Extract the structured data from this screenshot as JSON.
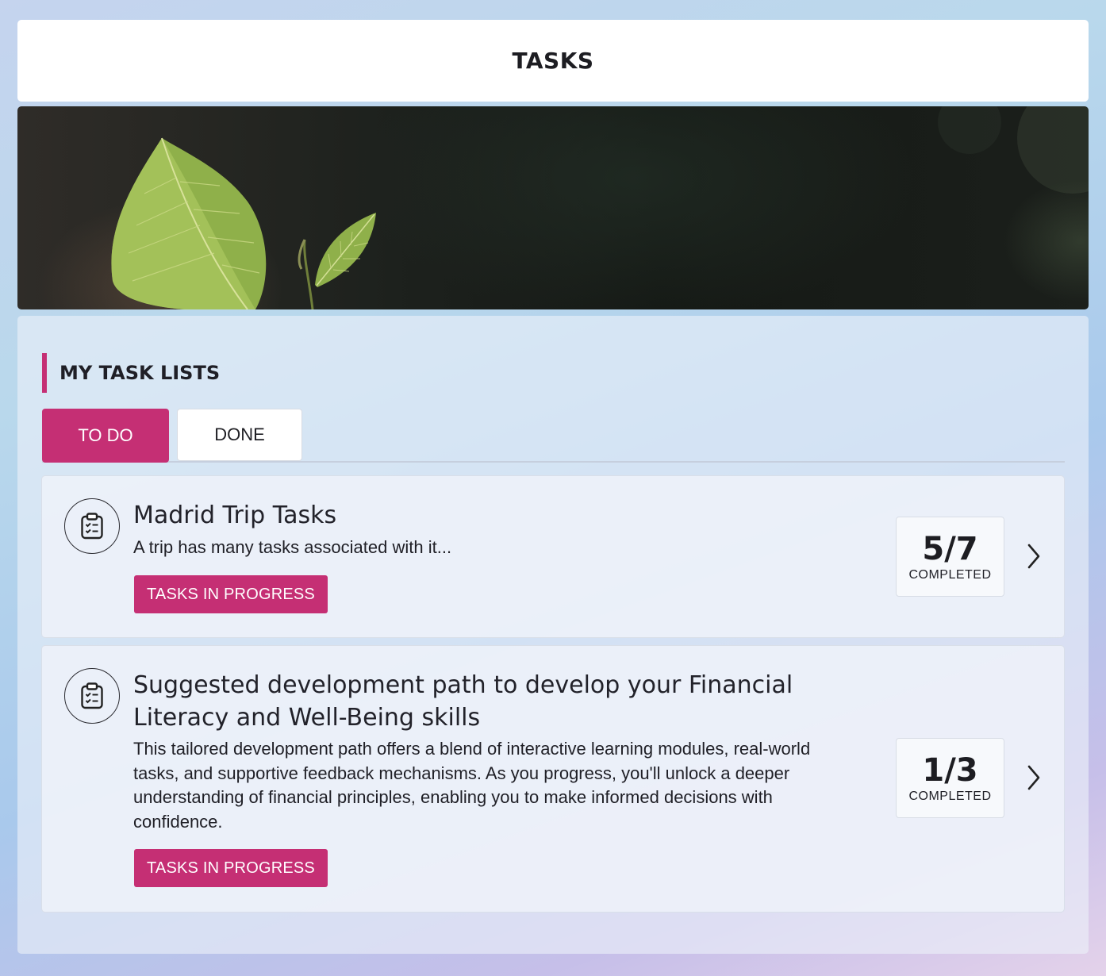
{
  "header": {
    "title": "TASKS"
  },
  "section": {
    "title": "MY TASK LISTS"
  },
  "tabs": [
    {
      "label": "TO DO",
      "active": true
    },
    {
      "label": "DONE",
      "active": false
    }
  ],
  "task_lists": [
    {
      "title": "Madrid Trip Tasks",
      "description": "A trip has many tasks associated with it...",
      "status": "TASKS IN PROGRESS",
      "progress": "5/7",
      "progress_label": "COMPLETED",
      "icon": "clipboard-checklist-icon"
    },
    {
      "title": "Suggested development path to develop your Financial Literacy and Well-Being skills",
      "description": "This tailored development path offers a blend of interactive learning modules, real-world tasks, and supportive feedback mechanisms. As you progress, you'll unlock a deeper understanding of financial principles, enabling you to make informed decisions with confidence.",
      "status": "TASKS IN PROGRESS",
      "progress": "1/3",
      "progress_label": "COMPLETED",
      "icon": "clipboard-checklist-icon"
    }
  ],
  "colors": {
    "accent": "#c52f74",
    "header_bg": "#ffffff",
    "text": "#1f1f24"
  }
}
